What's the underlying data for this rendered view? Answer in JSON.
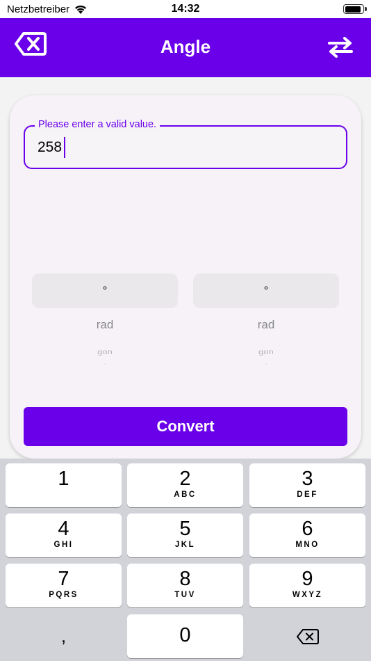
{
  "status_bar": {
    "carrier": "Netzbetreiber",
    "time": "14:32",
    "battery_level": 0.95
  },
  "header": {
    "title": "Angle",
    "clear_icon": "backspace-x-icon",
    "swap_icon": "swap-arrows-icon",
    "background_color": "#6a00ea"
  },
  "form": {
    "input_label": "Please enter a valid value.",
    "input_value": "258",
    "from_picker": {
      "selected": "°",
      "options": [
        "rad",
        "gon",
        "'"
      ]
    },
    "to_picker": {
      "selected": "°",
      "options": [
        "rad",
        "gon",
        "'"
      ]
    },
    "convert_label": "Convert"
  },
  "keyboard": {
    "keys": [
      {
        "num": "1",
        "letters": ""
      },
      {
        "num": "2",
        "letters": "ABC"
      },
      {
        "num": "3",
        "letters": "DEF"
      },
      {
        "num": "4",
        "letters": "GHI"
      },
      {
        "num": "5",
        "letters": "JKL"
      },
      {
        "num": "6",
        "letters": "MNO"
      },
      {
        "num": "7",
        "letters": "PQRS"
      },
      {
        "num": "8",
        "letters": "TUV"
      },
      {
        "num": "9",
        "letters": "WXYZ"
      }
    ],
    "comma": ",",
    "zero": "0",
    "delete_icon": "keyboard-delete-icon"
  }
}
